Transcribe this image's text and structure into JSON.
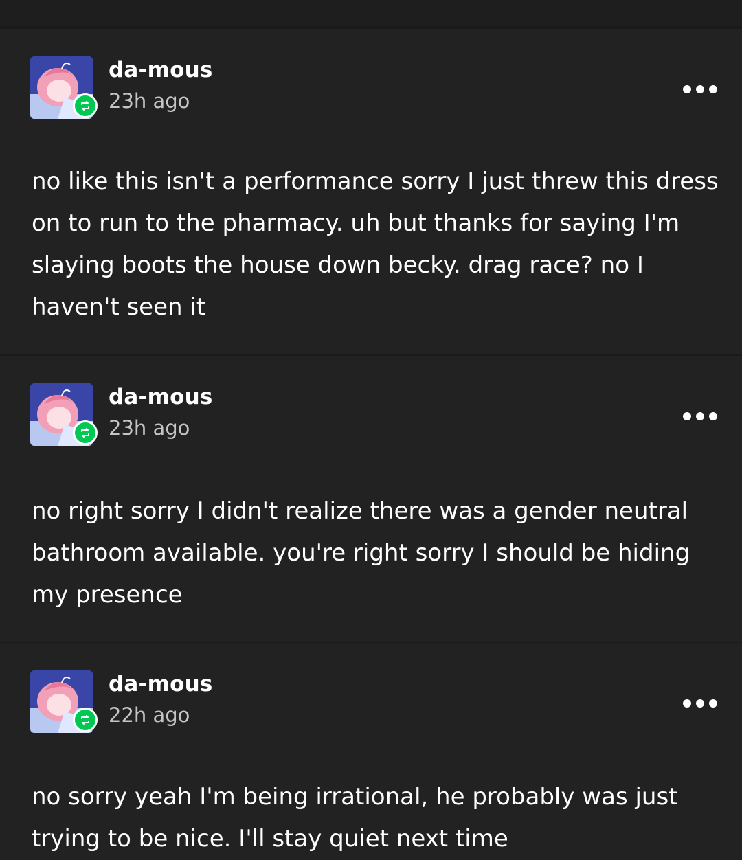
{
  "posts": [
    {
      "username": "da-mous",
      "timestamp": "23h ago",
      "avatar_icon": "reblog-icon",
      "body": "no like this isn't a performance sorry I just threw this dress on to run to the pharmacy. uh but thanks for saying I'm slaying boots the house down becky. drag race? no I haven't seen it"
    },
    {
      "username": "da-mous",
      "timestamp": "23h ago",
      "avatar_icon": "reblog-icon",
      "body": "no right sorry I didn't realize there was a gender neutral bathroom available. you're right sorry I should be hiding my presence"
    },
    {
      "username": "da-mous",
      "timestamp": "22h ago",
      "avatar_icon": "reblog-icon",
      "body": "no sorry yeah I'm being irrational, he probably was just trying to be nice. I'll stay quiet next time"
    }
  ],
  "colors": {
    "background": "#222222",
    "divider": "#1a1a1a",
    "text": "#ffffff",
    "muted_text": "#c4c4c4",
    "reblog_badge": "#00c853"
  }
}
